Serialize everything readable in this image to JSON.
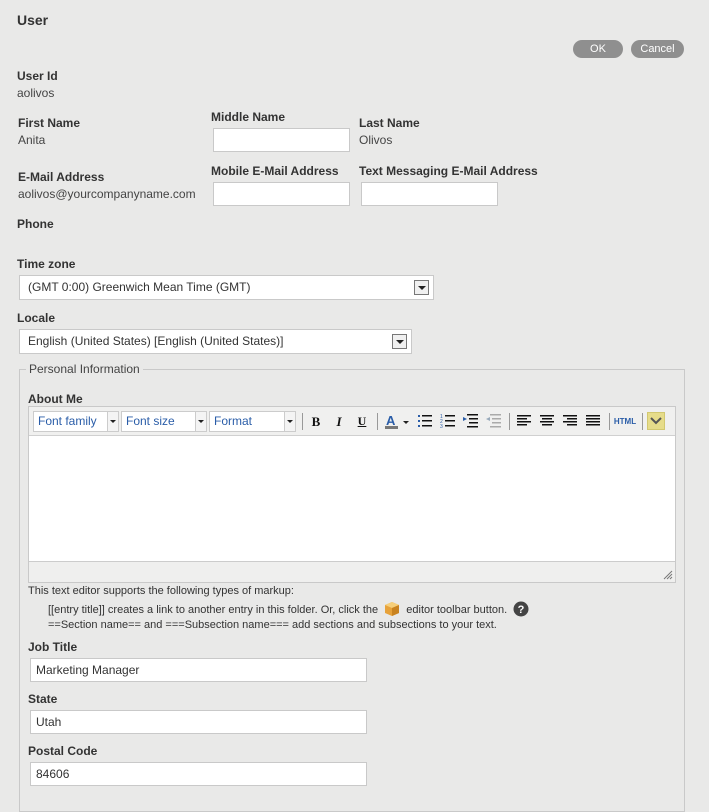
{
  "page": {
    "title": "User",
    "ok_label": "OK",
    "cancel_label": "Cancel"
  },
  "user": {
    "user_id_label": "User Id",
    "user_id": "aolivos",
    "first_name_label": "First Name",
    "first_name": "Anita",
    "middle_name_label": "Middle Name",
    "middle_name": "",
    "last_name_label": "Last Name",
    "last_name": "Olivos",
    "email_label": "E-Mail Address",
    "email": "aolivos@yourcompanyname.com",
    "mobile_email_label": "Mobile E-Mail Address",
    "mobile_email": "",
    "text_email_label": "Text Messaging E-Mail Address",
    "text_email": "",
    "phone_label": "Phone",
    "timezone_label": "Time zone",
    "timezone": "(GMT 0:00) Greenwich Mean Time (GMT)",
    "locale_label": "Locale",
    "locale": "English (United States) [English (United States)]"
  },
  "personal": {
    "legend": "Personal Information",
    "about_label": "About Me",
    "toolbar": {
      "font_family": "Font family",
      "font_size": "Font size",
      "format": "Format",
      "html": "HTML"
    },
    "help_line1": "This text editor supports the following types of markup:",
    "help_line2a": "[[entry title]] creates a link to another entry in this folder. Or, click the",
    "help_line2b": "editor toolbar button.",
    "help_line3": "==Section name== and ===Subsection name=== add sections and subsections to your text.",
    "job_title_label": "Job Title",
    "job_title": "Marketing Manager",
    "state_label": "State",
    "state": "Utah",
    "postal_label": "Postal Code",
    "postal": "84606"
  }
}
